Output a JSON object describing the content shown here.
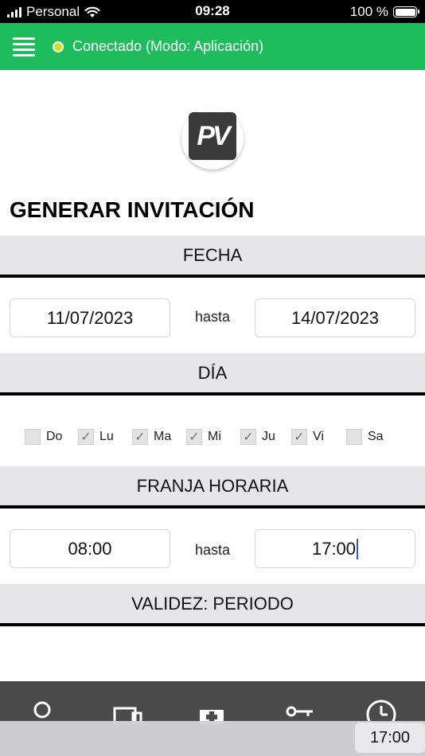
{
  "status_bar": {
    "carrier": "Personal",
    "time": "09:28",
    "battery": "100 %",
    "signal_icon": "cellular-signal-icon",
    "wifi_icon": "wifi-icon",
    "battery_icon": "battery-icon"
  },
  "header": {
    "menu_icon": "hamburger-menu-icon",
    "status_text": "Conectado (Modo: Aplicación)",
    "accent_color": "#1ebc5c",
    "status_dot_color": "#c8e51e"
  },
  "logo": {
    "text": "PV"
  },
  "page_title": "GENERAR INVITACIÓN",
  "sections": {
    "date": {
      "title": "FECHA",
      "from": "11/07/2023",
      "separator": "hasta",
      "to": "14/07/2023"
    },
    "day": {
      "title": "DÍA",
      "days": [
        {
          "label": "Do",
          "checked": false
        },
        {
          "label": "Lu",
          "checked": true
        },
        {
          "label": "Ma",
          "checked": true
        },
        {
          "label": "Mi",
          "checked": true
        },
        {
          "label": "Ju",
          "checked": true
        },
        {
          "label": "Vi",
          "checked": true
        },
        {
          "label": "Sa",
          "checked": false
        }
      ]
    },
    "time_range": {
      "title": "FRANJA HORARIA",
      "from": "08:00",
      "separator": "hasta",
      "to": "17:00"
    },
    "validity": {
      "title": "VALIDEZ: PERIODO"
    }
  },
  "bottom_nav": {
    "icons": [
      "user-icon",
      "devices-icon",
      "medical-kit-icon",
      "key-icon",
      "clock-icon"
    ]
  },
  "keyboard_suggestion": "17:00"
}
